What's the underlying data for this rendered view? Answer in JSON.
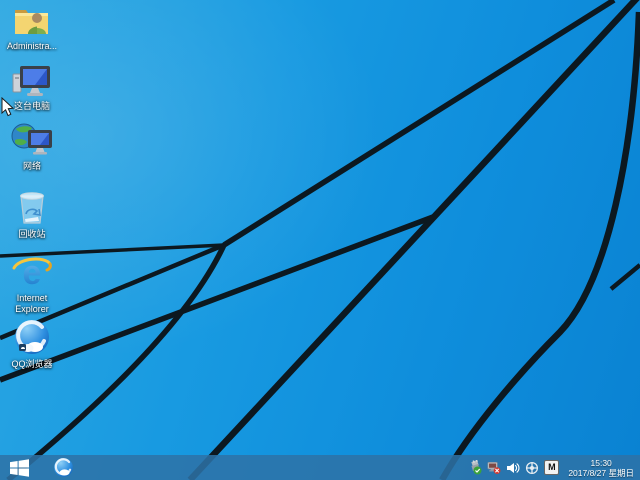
{
  "desktop": {
    "icons": [
      {
        "id": "administrator",
        "label": "Administra..."
      },
      {
        "id": "this-pc",
        "label": "这台电脑"
      },
      {
        "id": "network",
        "label": "网络"
      },
      {
        "id": "recycle-bin",
        "label": "回收站"
      },
      {
        "id": "internet-explorer",
        "label": "Internet Explorer"
      },
      {
        "id": "qq-browser",
        "label": "QQ浏览器"
      }
    ]
  },
  "taskbar": {
    "tray": {
      "icon_names": [
        "safely-remove-hardware-icon",
        "network-disconnected-icon",
        "volume-icon",
        "language-globe-icon",
        "ime-mode-m-icon"
      ],
      "ime_letter": "M"
    },
    "clock": {
      "time": "15:30",
      "date": "2017/8/27 星期日"
    }
  },
  "wallpaper": {
    "style": "windows-8.1-default-blue",
    "base_color_light": "#2ea8e2",
    "base_color_dark": "#0a82d2",
    "line_color": "#0c1820",
    "taskbar_color": "#2d72a6"
  }
}
